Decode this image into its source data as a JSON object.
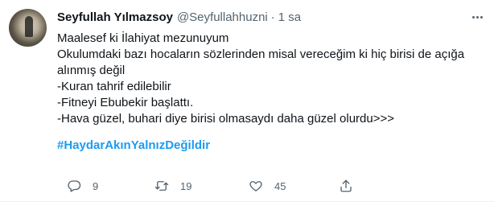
{
  "tweet": {
    "author_name": "Seyfullah Yılmazsoy",
    "handle": "@Seyfullahhuzni",
    "separator": "·",
    "time": "1 sa",
    "lines": [
      "Maalesef ki İlahiyat mezunuyum",
      "Okulumdaki bazı hocaların sözlerinden misal vereceğim ki hiç birisi de açığa",
      "alınmış değil",
      "-Kuran tahrif edilebilir",
      "-Fitneyi Ebubekir başlattı.",
      "-Hava güzel, buhari diye birisi olmasaydı daha güzel olurdu>>>"
    ],
    "hashtag": "#HaydarAkınYalnızDeğildir"
  },
  "actions": {
    "reply_count": "9",
    "retweet_count": "19",
    "like_count": "45"
  },
  "icons": {
    "reply": "reply-icon",
    "retweet": "retweet-icon",
    "like": "heart-icon",
    "share": "share-icon",
    "more": "more-icon"
  },
  "colors": {
    "text": "#0f1419",
    "secondary": "#536471",
    "link": "#1d9bf0"
  }
}
